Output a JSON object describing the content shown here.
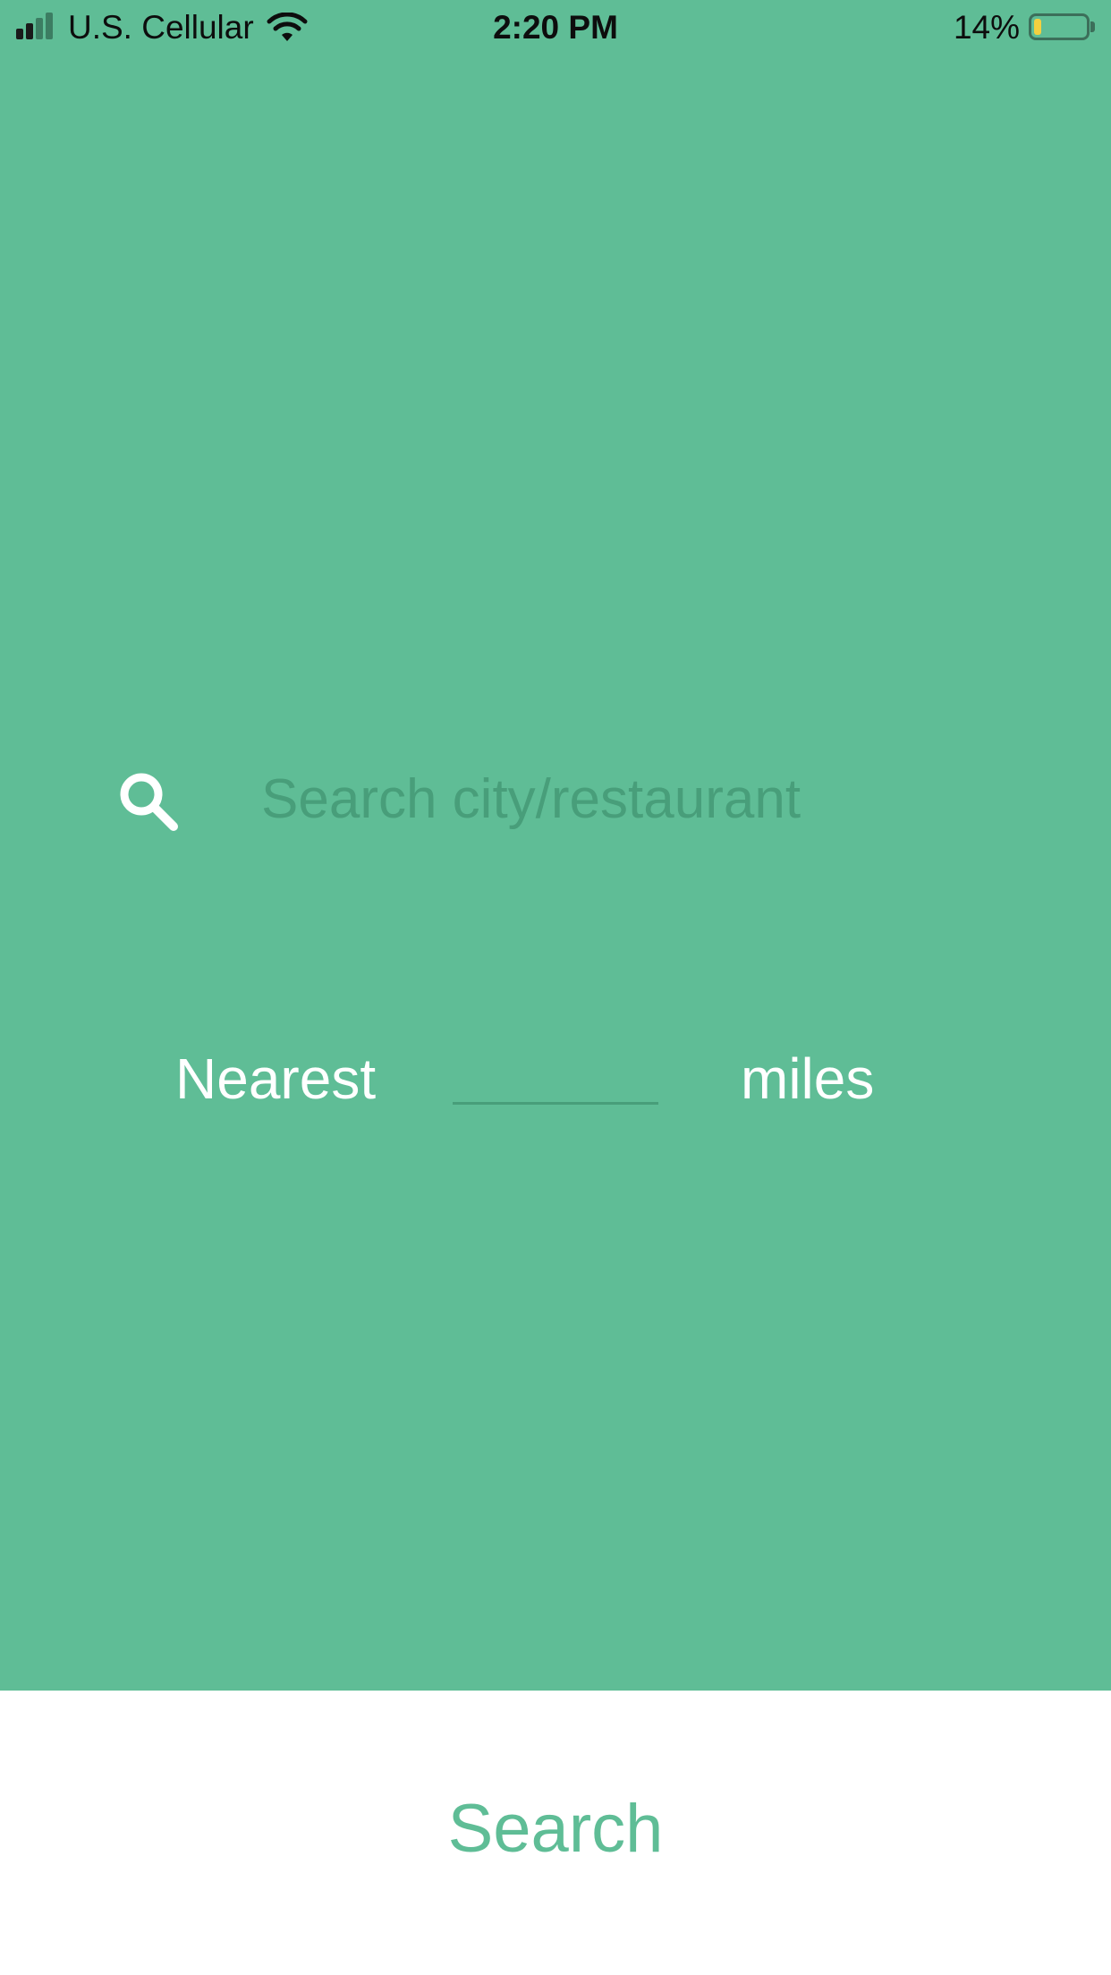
{
  "status_bar": {
    "carrier": "U.S. Cellular",
    "time": "2:20 PM",
    "battery_percent": "14%",
    "battery_level": 0.14,
    "signal_bars_active": 2,
    "signal_bars_total": 4
  },
  "search": {
    "placeholder": "Search city/restaurant",
    "value": "",
    "icon": "search-icon"
  },
  "distance": {
    "prefix_label": "Nearest",
    "value": "",
    "suffix_label": "miles"
  },
  "action": {
    "search_label": "Search"
  },
  "colors": {
    "primary_green": "#5fbd96",
    "placeholder_green": "#489e7a",
    "white": "#ffffff",
    "battery_yellow": "#f4d03f",
    "signal_active": "#1a1a1a",
    "signal_inactive": "#3c7d62"
  }
}
